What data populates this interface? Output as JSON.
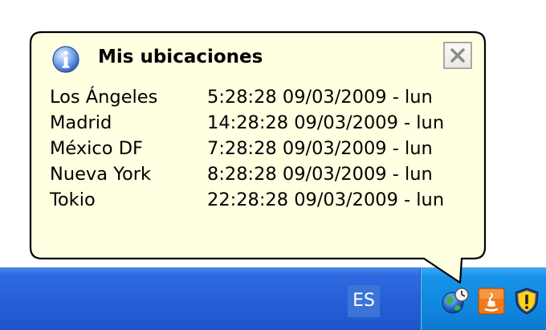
{
  "balloon": {
    "title": "Mis ubicaciones",
    "title_icon": "info-icon",
    "close_icon": "close-icon",
    "locations": [
      {
        "city": "Los Ángeles",
        "time": "5:28:28 09/03/2009 - lun"
      },
      {
        "city": "Madrid",
        "time": "14:28:28 09/03/2009 - lun"
      },
      {
        "city": "México DF",
        "time": "7:28:28 09/03/2009 - lun"
      },
      {
        "city": "Nueva York",
        "time": "8:28:28 09/03/2009 - lun"
      },
      {
        "city": "Tokio",
        "time": "22:28:28 09/03/2009 - lun"
      }
    ]
  },
  "taskbar": {
    "language": "ES",
    "tray_icons": [
      "globe-clock-icon",
      "java-icon",
      "security-shield-icon"
    ]
  },
  "colors": {
    "balloon_background": "#ffffe1",
    "taskbar_blue": "#245ed7",
    "tray_blue": "#0f85dd"
  }
}
